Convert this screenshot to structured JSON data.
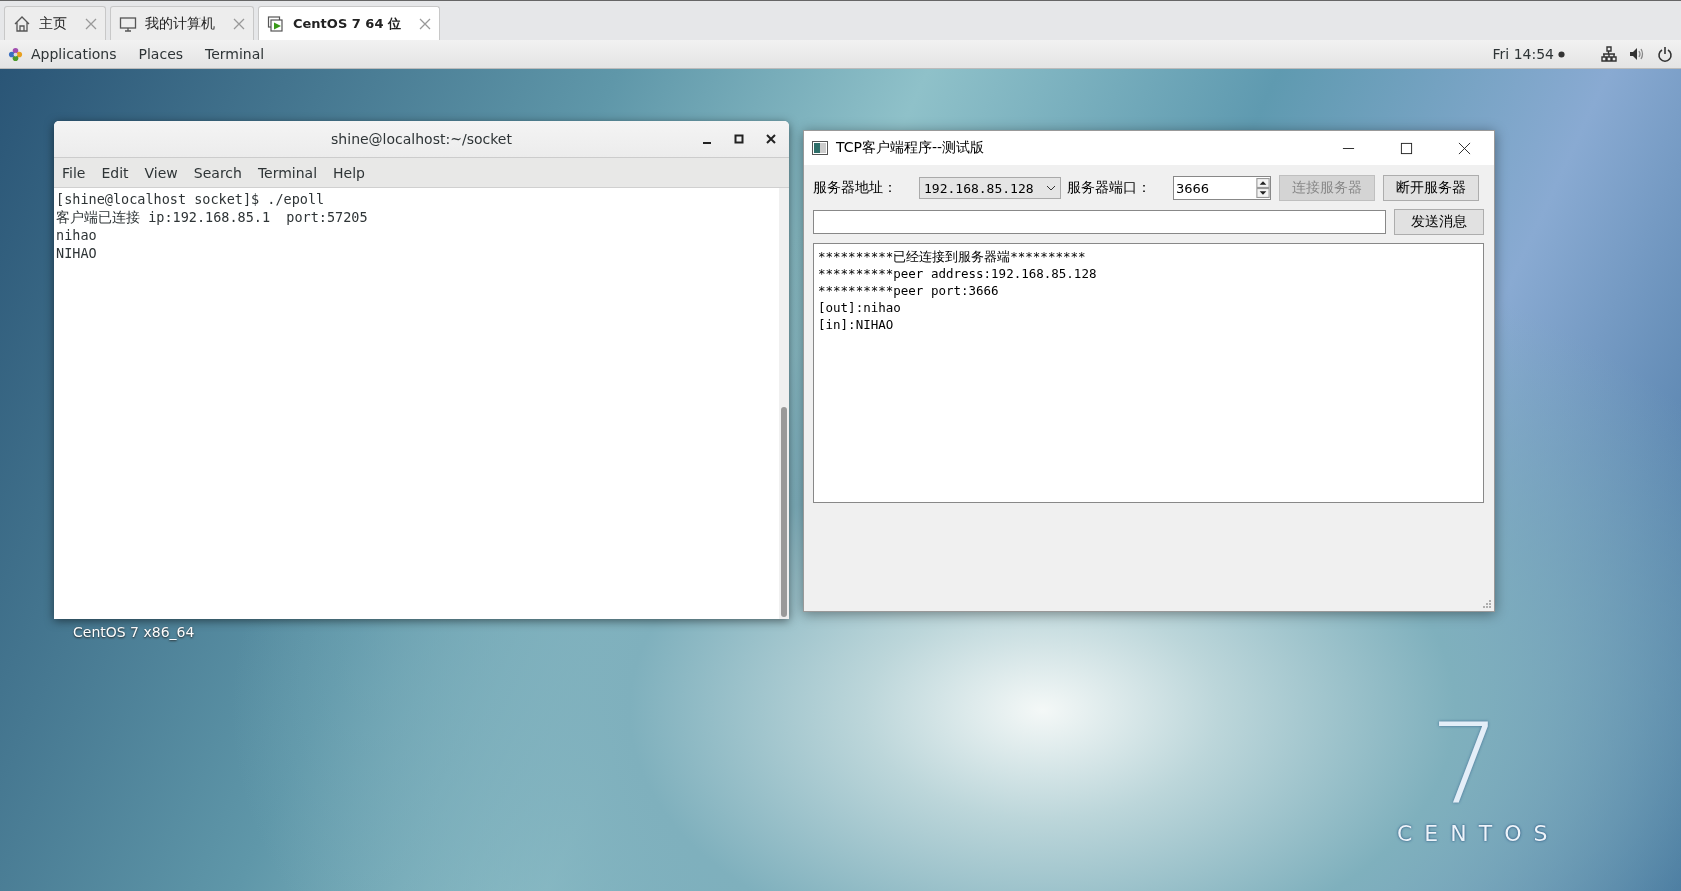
{
  "vm_tabs": [
    {
      "label": "主页",
      "kind": "home",
      "selected": false
    },
    {
      "label": "我的计算机",
      "kind": "computer",
      "selected": false
    },
    {
      "label": "CentOS 7 64 位",
      "kind": "vm",
      "selected": true
    }
  ],
  "panel": {
    "menus": [
      "Applications",
      "Places",
      "Terminal"
    ],
    "clock": "Fri 14:54"
  },
  "desktop": {
    "icon_label": "CentOS 7 x86_64",
    "logo_number": "7",
    "logo_word": "CENTOS"
  },
  "terminal": {
    "title": "shine@localhost:~/socket",
    "menu": [
      "File",
      "Edit",
      "View",
      "Search",
      "Terminal",
      "Help"
    ],
    "lines": [
      "[shine@localhost socket]$ ./epoll",
      "客户端已连接 ip:192.168.85.1  port:57205",
      "nihao",
      "NIHAO"
    ]
  },
  "tcp_client": {
    "title": "TCP客户端程序--测试版",
    "address_label": "服务器地址：",
    "address": "192.168.85.128",
    "port_label": "服务器端口：",
    "port": "3666",
    "buttons": [
      {
        "label": "连接服务器",
        "disabled": true
      },
      {
        "label": "断开服务器",
        "disabled": false
      }
    ],
    "send_button": "发送消息",
    "log": [
      "**********已经连接到服务器端**********",
      "**********peer address:192.168.85.128",
      "**********peer port:3666",
      "[out]:nihao",
      "[in]:NIHAO"
    ]
  }
}
